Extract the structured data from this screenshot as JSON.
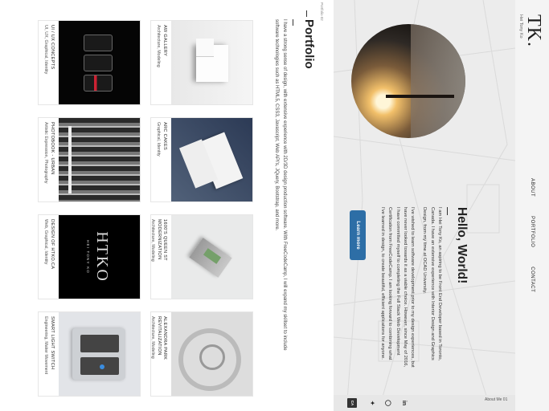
{
  "nav": {
    "logo": "TK.",
    "subtitle": "Hei Tony Ko",
    "links": [
      "ABOUT",
      "PORTFOLIO",
      "CONTACT"
    ]
  },
  "hero": {
    "title": "Hello, World!",
    "paragraphs": [
      "I am Hei Tony Ko, an aspiring to be Front End Developer based in Toronto, Canada. I have an extensive experience with Interior Design and Graphics Design, from my time at OCAD University.",
      "I've wished to learn software development prior to my design experiences, but have never looked towards it as a viable choice. However, since May of 2016, I have committed myself to completing the Full Stack Web Development Certification from FreeCodeCamp. I am looking forward to combining what I've learned in design, to create beautiful, efficient applications for anyone."
    ],
    "button_label": "Learn more"
  },
  "social": {
    "section_label": "About Me 01",
    "icons": [
      "linkedin-icon",
      "github-icon",
      "twitter-icon",
      "flag-icon"
    ],
    "flag_text": "CA"
  },
  "portfolio": {
    "section_label": "Portfolio 02",
    "title": "Portfolio",
    "description": "I have a strong sense of design, with extensive experience with 2D/3D design production software. With FreeCodeCamp, I will expand my skillset to include software technologies such as HTML5, CSS3, Javascript, Web API's, JQuery, Bootstrap, and more.",
    "items": [
      {
        "name": "AW GALLERY",
        "tags": "Architecture, Modeling"
      },
      {
        "name": "ARC CAKES",
        "tags": "Graphical, Identity"
      },
      {
        "name": "1600'S QUEEN ST MODERNIZATION",
        "tags": "Architecture, Modeling"
      },
      {
        "name": "ALEXANDRA PARK REVITALIZATION",
        "tags": "Architecture, Modeling"
      },
      {
        "name": "UI / UX CONCEPTS",
        "tags": "UI, UX, Graphical, Identity"
      },
      {
        "name": "PHOTOBOOK - URBAN",
        "tags": "Artistic Expression, Photography"
      },
      {
        "name": "DESIGN OF HTKO.CA",
        "tags": "Web, Graphical, Identity"
      },
      {
        "name": "SMART LIGHT SWITCH",
        "tags": "Engineering, Maker Movement"
      }
    ],
    "logo_text": "HTKO",
    "logo_subtext": "HEI TONY KO"
  },
  "colors": {
    "accent": "#2d6ea6",
    "hero_bg": "#ececec"
  }
}
